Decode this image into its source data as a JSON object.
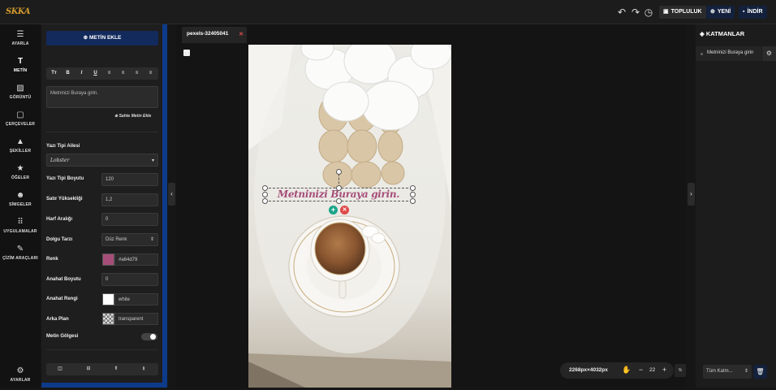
{
  "topbar": {
    "logo": "SKKA",
    "icons": [
      "undo-icon",
      "redo-icon",
      "history-icon"
    ],
    "community_label": "TOPLULUK",
    "new_label": "YENİ",
    "download_label": "İNDİR"
  },
  "sidebar": {
    "items": [
      {
        "label": "AYARLA",
        "icon": "sliders-icon"
      },
      {
        "label": "METİN",
        "icon": "text-icon",
        "active": true
      },
      {
        "label": "GÖRÜNTÜ",
        "icon": "image-icon"
      },
      {
        "label": "ÇERÇEVELER",
        "icon": "frame-icon"
      },
      {
        "label": "ŞEKİLLER",
        "icon": "shapes-icon"
      },
      {
        "label": "ÖĞELER",
        "icon": "star-icon"
      },
      {
        "label": "SİMGELER",
        "icon": "emoji-icon"
      },
      {
        "label": "UYGULAMALAR",
        "icon": "apps-icon"
      },
      {
        "label": "ÇİZİM ARAÇLARI",
        "icon": "brush-icon"
      }
    ],
    "settings_label": "AYARLAR"
  },
  "text_panel": {
    "add_text_label": "METİN EKLE",
    "format_buttons": [
      "Tт",
      "B",
      "I",
      "U",
      "≡",
      "≡",
      "≡",
      "≡"
    ],
    "text_placeholder": "Metninizi Buraya girin.",
    "curved_label": "Sahte Metin Ekle",
    "font_family_label": "Yazı Tipi Ailesi",
    "font_family_value": "Lobster",
    "font_size_label": "Yazı Tipi Boyutu",
    "font_size_value": "120",
    "line_height_label": "Satır Yüksekliği",
    "line_height_value": "1,2",
    "letter_spacing_label": "Harf Aralığı",
    "letter_spacing_value": "0",
    "fill_style_label": "Dolgu Tarzı",
    "fill_style_value": "Düz Renk",
    "color_label": "Renk",
    "color_value": "#a64d79",
    "outline_size_label": "Anahat Boyutu",
    "outline_size_value": "0",
    "outline_color_label": "Anahat Rengi",
    "outline_color_value": "white",
    "background_label": "Arka Plan",
    "background_value": "transparent",
    "shadow_label": "Metin Gölgesi"
  },
  "canvas": {
    "tab_name": "pexels-32405041",
    "overlay_text": "Metninizi Buraya girin.",
    "overlay_color": "#a64d79",
    "dimensions": "2268px×4032px",
    "zoom_value": "22",
    "zoom_unit": "%"
  },
  "layers_panel": {
    "title": "KATMANLAR",
    "layers": [
      {
        "name": "Metninizi Buraya girin"
      }
    ],
    "filter_value": "Tüm Katm..."
  }
}
